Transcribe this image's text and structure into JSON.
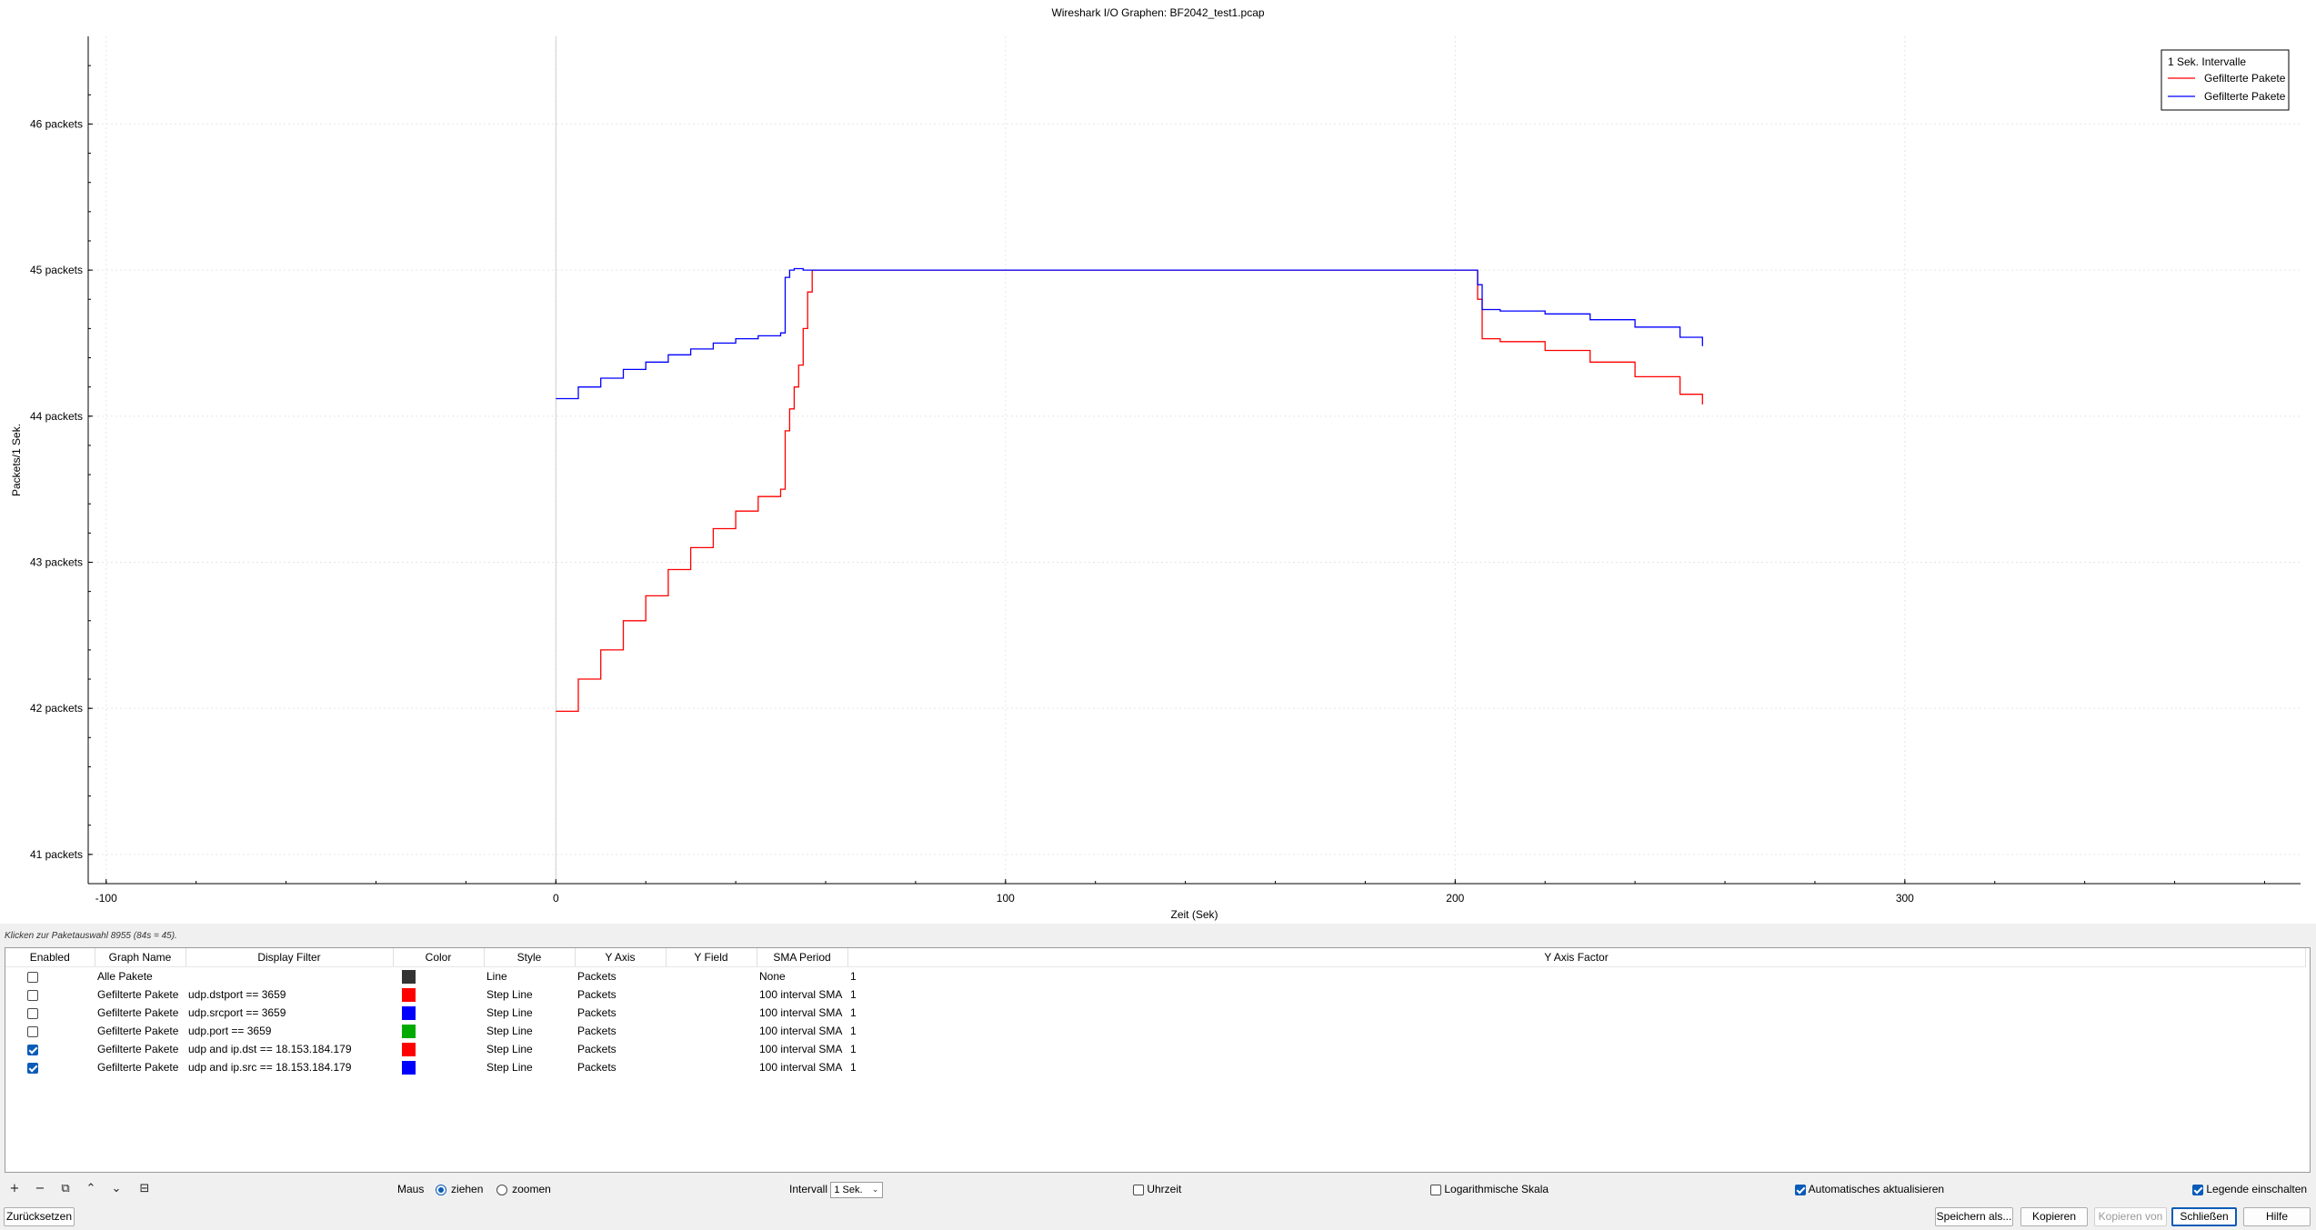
{
  "window": {
    "title": "Wireshark I/O Graphen: BF2042_test1.pcap"
  },
  "chart_data": {
    "type": "line",
    "title": "",
    "xlabel": "Zeit (Sek)",
    "ylabel": "Packets/1 Sek.",
    "xlim": [
      -104,
      388
    ],
    "ylim": [
      40.8,
      46.6
    ],
    "x_ticks": [
      -100,
      0,
      100,
      200,
      300
    ],
    "x_tick_labels": [
      "-100",
      "0",
      "100",
      "200",
      "300"
    ],
    "y_ticks": [
      41,
      42,
      43,
      44,
      45,
      46
    ],
    "y_tick_labels": [
      "41 packets",
      "42 packets",
      "43 packets",
      "44 packets",
      "45 packets",
      "46 packets"
    ],
    "grid": true,
    "legend": {
      "title": "1 Sek. Intervalle",
      "placement": "top-right"
    },
    "series": [
      {
        "name": "Gefilterte Pakete",
        "color": "#ff0000",
        "style": "step",
        "x": [
          0,
          5,
          10,
          15,
          20,
          25,
          30,
          35,
          40,
          45,
          50,
          51,
          52,
          53,
          54,
          55,
          56,
          57,
          60,
          80,
          100,
          150,
          200,
          204,
          205,
          206,
          210,
          220,
          230,
          240,
          250,
          255
        ],
        "y": [
          41.98,
          42.2,
          42.4,
          42.6,
          42.77,
          42.95,
          43.1,
          43.23,
          43.35,
          43.45,
          43.5,
          43.9,
          44.05,
          44.2,
          44.35,
          44.6,
          44.85,
          45.0,
          45.0,
          45.0,
          45.0,
          45.0,
          45.0,
          45.0,
          44.8,
          44.53,
          44.51,
          44.45,
          44.37,
          44.27,
          44.15,
          44.08
        ]
      },
      {
        "name": "Gefilterte Pakete",
        "color": "#0000ff",
        "style": "step",
        "x": [
          0,
          5,
          10,
          15,
          20,
          25,
          30,
          35,
          40,
          45,
          50,
          51,
          52,
          53,
          55,
          60,
          80,
          100,
          150,
          200,
          204,
          205,
          206,
          210,
          220,
          230,
          240,
          250,
          255
        ],
        "y": [
          44.12,
          44.2,
          44.26,
          44.32,
          44.37,
          44.42,
          44.46,
          44.5,
          44.53,
          44.55,
          44.57,
          44.95,
          45.0,
          45.01,
          45.0,
          45.0,
          45.0,
          45.0,
          45.0,
          45.0,
          45.0,
          44.9,
          44.73,
          44.72,
          44.7,
          44.66,
          44.61,
          44.54,
          44.48
        ]
      }
    ]
  },
  "status_text": "Klicken zur Paketauswahl 8955 (84s = 45).",
  "table": {
    "headers": [
      "Enabled",
      "Graph Name",
      "Display Filter",
      "Color",
      "Style",
      "Y Axis",
      "Y Field",
      "SMA Period",
      "Y Axis Factor"
    ],
    "rows": [
      {
        "enabled": false,
        "name": "Alle Pakete",
        "filter": "",
        "color": "#333333",
        "style": "Line",
        "y_axis": "Packets",
        "y_field": "",
        "sma": "None",
        "factor": "1"
      },
      {
        "enabled": false,
        "name": "Gefilterte Pakete",
        "filter": "udp.dstport == 3659",
        "color": "#ff0000",
        "style": "Step Line",
        "y_axis": "Packets",
        "y_field": "",
        "sma": "100 interval SMA",
        "factor": "1"
      },
      {
        "enabled": false,
        "name": "Gefilterte Pakete",
        "filter": "udp.srcport == 3659",
        "color": "#0000ff",
        "style": "Step Line",
        "y_axis": "Packets",
        "y_field": "",
        "sma": "100 interval SMA",
        "factor": "1"
      },
      {
        "enabled": false,
        "name": "Gefilterte Pakete",
        "filter": "udp.port == 3659",
        "color": "#00aa00",
        "style": "Step Line",
        "y_axis": "Packets",
        "y_field": "",
        "sma": "100 interval SMA",
        "factor": "1"
      },
      {
        "enabled": true,
        "name": "Gefilterte Pakete",
        "filter": "udp and ip.dst == 18.153.184.179",
        "color": "#ff0000",
        "style": "Step Line",
        "y_axis": "Packets",
        "y_field": "",
        "sma": "100 interval SMA",
        "factor": "1"
      },
      {
        "enabled": true,
        "name": "Gefilterte Pakete",
        "filter": "udp and ip.src == 18.153.184.179",
        "color": "#0000ff",
        "style": "Step Line",
        "y_axis": "Packets",
        "y_field": "",
        "sma": "100 interval SMA",
        "factor": "1"
      }
    ]
  },
  "toolbar": {
    "buttons": [
      {
        "name": "add-graph-button",
        "icon": "plus-icon",
        "glyph": "+"
      },
      {
        "name": "remove-graph-button",
        "icon": "minus-icon",
        "glyph": "−"
      },
      {
        "name": "copy-graph-button",
        "icon": "copy-icon",
        "glyph": "⧉"
      },
      {
        "name": "move-up-button",
        "icon": "arrow-up-icon",
        "glyph": "⌃"
      },
      {
        "name": "move-down-button",
        "icon": "arrow-down-icon",
        "glyph": "⌄"
      },
      {
        "name": "clear-button",
        "icon": "clear-icon",
        "glyph": "⊟"
      }
    ],
    "mouse_label": "Maus",
    "drag_label": "ziehen",
    "drag_selected": true,
    "zoom_label": "zoomen",
    "zoom_selected": false,
    "interval_label": "Intervall",
    "interval_value": "1 Sek.",
    "time_of_day_label": "Uhrzeit",
    "time_of_day_checked": false,
    "log_scale_label": "Logarithmische Skala",
    "log_scale_checked": false,
    "auto_update_label": "Automatisches aktualisieren",
    "auto_update_checked": true,
    "legend_label": "Legende einschalten",
    "legend_checked": true
  },
  "buttons": {
    "reset": "Zurücksetzen",
    "save_as": "Speichern als...",
    "copy": "Kopieren",
    "copy_from": "Kopieren von",
    "close": "Schließen",
    "help": "Hilfe"
  }
}
